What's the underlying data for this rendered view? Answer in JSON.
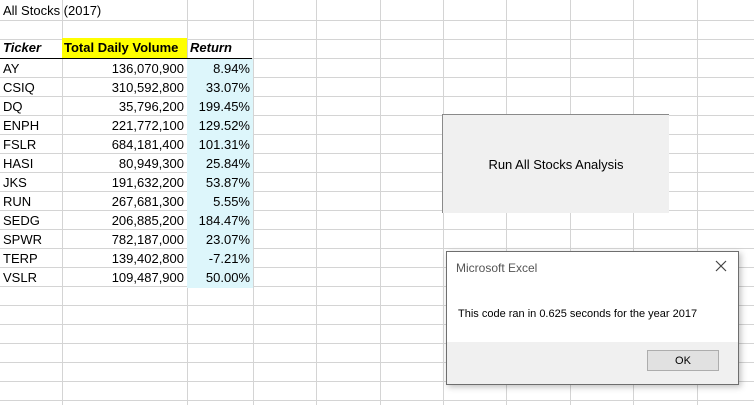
{
  "sheet": {
    "title": "All Stocks (2017)",
    "headers": {
      "ticker": "Ticker",
      "volume": "Total Daily Volume",
      "ret": "Return"
    },
    "rows": [
      {
        "ticker": "AY",
        "volume": "136,070,900",
        "ret": "8.94%"
      },
      {
        "ticker": "CSIQ",
        "volume": "310,592,800",
        "ret": "33.07%"
      },
      {
        "ticker": "DQ",
        "volume": "35,796,200",
        "ret": "199.45%"
      },
      {
        "ticker": "ENPH",
        "volume": "221,772,100",
        "ret": "129.52%"
      },
      {
        "ticker": "FSLR",
        "volume": "684,181,400",
        "ret": "101.31%"
      },
      {
        "ticker": "HASI",
        "volume": "80,949,300",
        "ret": "25.84%"
      },
      {
        "ticker": "JKS",
        "volume": "191,632,200",
        "ret": "53.87%"
      },
      {
        "ticker": "RUN",
        "volume": "267,681,300",
        "ret": "5.55%"
      },
      {
        "ticker": "SEDG",
        "volume": "206,885,200",
        "ret": "184.47%"
      },
      {
        "ticker": "SPWR",
        "volume": "782,187,000",
        "ret": "23.07%"
      },
      {
        "ticker": "TERP",
        "volume": "139,402,800",
        "ret": "-7.21%"
      },
      {
        "ticker": "VSLR",
        "volume": "109,487,900",
        "ret": "50.00%"
      }
    ]
  },
  "macro_button": {
    "label": "Run All Stocks Analysis"
  },
  "dialog": {
    "title": "Microsoft Excel",
    "message": "This code ran in 0.625 seconds for the year 2017",
    "ok_label": "OK"
  },
  "colors": {
    "header_highlight": "#ffff00",
    "return_fill": "#ddf6fb",
    "gridline": "#d4d4d4"
  }
}
